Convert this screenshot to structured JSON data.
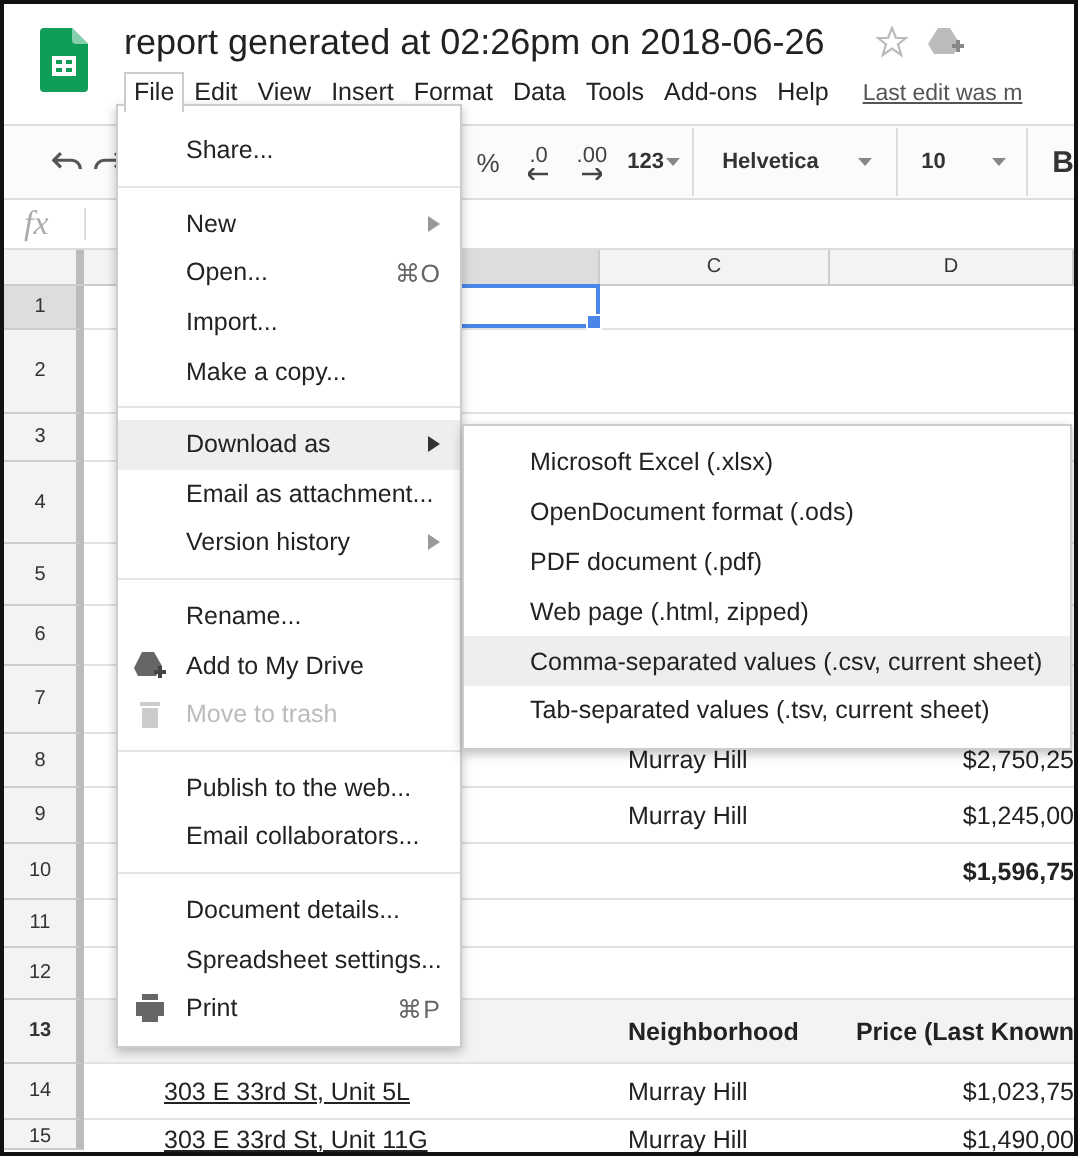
{
  "document": {
    "title": "report generated at 02:26pm on 2018-06-26",
    "last_edit": "Last edit was m"
  },
  "menubar": [
    {
      "label": "File",
      "selected": true
    },
    {
      "label": "Edit",
      "selected": false
    },
    {
      "label": "View",
      "selected": false
    },
    {
      "label": "Insert",
      "selected": false
    },
    {
      "label": "Format",
      "selected": false
    },
    {
      "label": "Data",
      "selected": false
    },
    {
      "label": "Tools",
      "selected": false
    },
    {
      "label": "Add-ons",
      "selected": false
    },
    {
      "label": "Help",
      "selected": false
    }
  ],
  "toolbar": {
    "percent": "%",
    "decrease_decimal": ".0",
    "increase_decimal": ".00",
    "more_formats": "123",
    "font": "Helvetica",
    "font_size": "10",
    "bold": "B"
  },
  "formula_bar": {
    "label": "fx"
  },
  "column_headers": [
    {
      "selected": true
    },
    {
      "label": "C",
      "selected": false
    },
    {
      "label": "D",
      "selected": false
    }
  ],
  "rows": [
    {
      "number": "1",
      "selected": true,
      "kind": "data"
    },
    {
      "number": "2",
      "selected": false,
      "kind": "data"
    },
    {
      "number": "3",
      "selected": false,
      "kind": "data"
    },
    {
      "number": "4",
      "selected": false,
      "kind": "data"
    },
    {
      "number": "5",
      "selected": false,
      "kind": "data"
    },
    {
      "number": "6",
      "selected": false,
      "kind": "data"
    },
    {
      "number": "7",
      "selected": false,
      "kind": "data"
    },
    {
      "number": "8",
      "selected": false,
      "kind": "data",
      "c": "Murray Hill",
      "d": "$2,750,25"
    },
    {
      "number": "9",
      "selected": false,
      "kind": "data",
      "c": "Murray Hill",
      "d": "$1,245,00"
    },
    {
      "number": "10",
      "selected": false,
      "kind": "total",
      "d": "$1,596,75"
    },
    {
      "number": "11",
      "selected": false,
      "kind": "data"
    },
    {
      "number": "12",
      "selected": false,
      "kind": "data"
    },
    {
      "number": "13",
      "selected": false,
      "kind": "header",
      "c": "Neighborhood",
      "d": "Price (Last Known"
    },
    {
      "number": "14",
      "selected": false,
      "kind": "data",
      "b": "303 E 33rd St, Unit 5L",
      "c": "Murray Hill",
      "d": "$1,023,75"
    },
    {
      "number": "15",
      "selected": false,
      "kind": "data",
      "b": "303 E 33rd St, Unit 11G",
      "c": "Murray Hill",
      "d": "$1,490,00"
    }
  ],
  "file_menu": {
    "sections": [
      [
        {
          "label": "Share...",
          "kind": "text",
          "highlighted": false,
          "disabled": false,
          "submenu": false
        }
      ],
      [
        {
          "label": "New",
          "kind": "text",
          "highlighted": false,
          "disabled": false,
          "submenu": true
        },
        {
          "label": "Open...",
          "shortcut": "⌘O",
          "kind": "text",
          "highlighted": false,
          "disabled": false,
          "submenu": false
        },
        {
          "label": "Import...",
          "kind": "text",
          "highlighted": false,
          "disabled": false,
          "submenu": false
        },
        {
          "label": "Make a copy...",
          "kind": "text",
          "highlighted": false,
          "disabled": false,
          "submenu": false
        }
      ],
      [
        {
          "label": "Download as",
          "kind": "text",
          "highlighted": true,
          "disabled": false,
          "submenu": true
        },
        {
          "label": "Email as attachment...",
          "kind": "text",
          "highlighted": false,
          "disabled": false,
          "submenu": false
        },
        {
          "label": "Version history",
          "kind": "text",
          "highlighted": false,
          "disabled": false,
          "submenu": true
        }
      ],
      [
        {
          "label": "Rename...",
          "kind": "text",
          "highlighted": false,
          "disabled": false,
          "submenu": false
        },
        {
          "label": "Add to My Drive",
          "kind": "drive",
          "highlighted": false,
          "disabled": false,
          "submenu": false
        },
        {
          "label": "Move to trash",
          "kind": "trash",
          "highlighted": false,
          "disabled": true,
          "submenu": false
        }
      ],
      [
        {
          "label": "Publish to the web...",
          "kind": "text",
          "highlighted": false,
          "disabled": false,
          "submenu": false
        },
        {
          "label": "Email collaborators...",
          "kind": "text",
          "highlighted": false,
          "disabled": false,
          "submenu": false
        }
      ],
      [
        {
          "label": "Document details...",
          "kind": "text",
          "highlighted": false,
          "disabled": false,
          "submenu": false
        },
        {
          "label": "Spreadsheet settings...",
          "kind": "text",
          "highlighted": false,
          "disabled": false,
          "submenu": false
        },
        {
          "label": "Print",
          "shortcut": "⌘P",
          "kind": "print",
          "highlighted": false,
          "disabled": false,
          "submenu": false
        }
      ]
    ]
  },
  "download_submenu": [
    {
      "label": "Microsoft Excel (.xlsx)",
      "highlighted": false
    },
    {
      "label": "OpenDocument format (.ods)",
      "highlighted": false
    },
    {
      "label": "PDF document (.pdf)",
      "highlighted": false
    },
    {
      "label": "Web page (.html, zipped)",
      "highlighted": false
    },
    {
      "label": "Comma-separated values (.csv, current sheet)",
      "highlighted": true
    },
    {
      "label": "Tab-separated values (.tsv, current sheet)",
      "highlighted": false
    }
  ]
}
